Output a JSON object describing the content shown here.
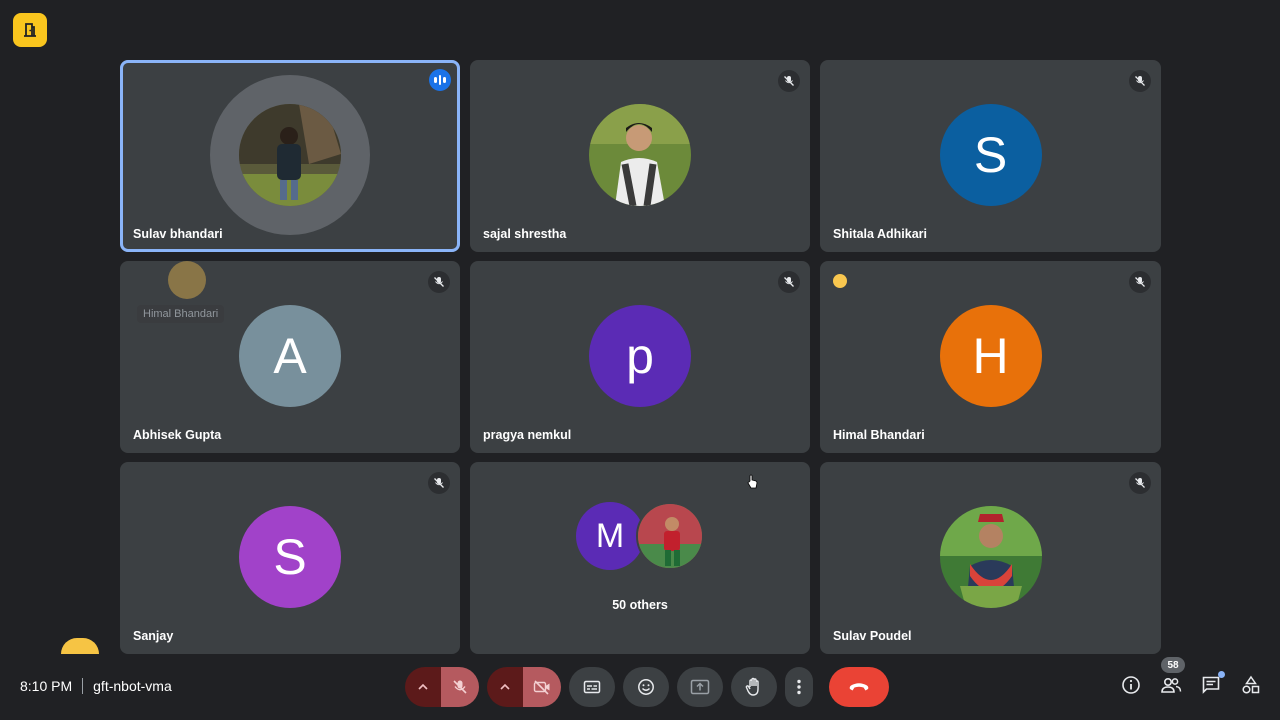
{
  "meeting": {
    "time": "8:10 PM",
    "code": "gft-nbot-vma"
  },
  "participants_count": "58",
  "tiles": [
    {
      "name": "Sulav bhandari",
      "avatar": "photo",
      "speaking": true
    },
    {
      "name": "sajal shrestha",
      "avatar": "photo",
      "muted": true
    },
    {
      "name": "Shitala Adhikari",
      "initial": "S",
      "color": "#0b5fa0",
      "muted": true
    },
    {
      "name": "Abhisek Gupta",
      "initial": "A",
      "color": "#78909c",
      "muted": true
    },
    {
      "name": "pragya nemkul",
      "initial": "p",
      "color": "#5b2bb5",
      "muted": true
    },
    {
      "name": "Himal Bhandari",
      "initial": "H",
      "color": "#e8710a",
      "muted": true
    },
    {
      "name": "Sanjay",
      "initial": "S",
      "color": "#a142c9",
      "muted": true
    },
    {
      "others": "50 others",
      "initial": "M",
      "color": "#5b2bb5"
    },
    {
      "name": "Sulav Poudel",
      "avatar": "photo",
      "muted": true
    }
  ],
  "reaction_label": "Himal Bhandari",
  "colors": {
    "background": "#202124",
    "tile": "#3c4043",
    "accent": "#8ab4f8",
    "end_call": "#ea4335",
    "brand": "#f9c51e"
  }
}
